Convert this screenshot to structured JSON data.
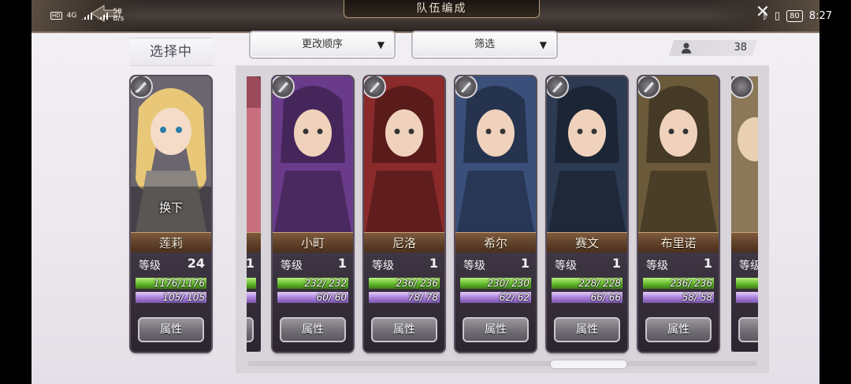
{
  "status_bar": {
    "left_network": "4G",
    "left_speed": "50",
    "left_speed_unit": "B/s",
    "battery": "80",
    "time": "8:27"
  },
  "header": {
    "title": "队伍编成"
  },
  "selecting_label": "选择中",
  "controls": {
    "sort_label": "更改顺序",
    "filter_label": "筛选",
    "unit_count": "38"
  },
  "selected_card": {
    "name": "莲莉",
    "swap_label": "换下",
    "level_label": "等级",
    "level": "24",
    "hp": "1176/1176",
    "mp": "105/  105",
    "attr_label": "属性"
  },
  "cards": [
    {
      "name": "小町",
      "level_label": "等级",
      "level": "1",
      "hp": "232/  232",
      "mp": "60/   60",
      "attr_label": "属性",
      "accent": "#6a3b8a"
    },
    {
      "name": "尼洛",
      "level_label": "等级",
      "level": "1",
      "hp": "236/  236",
      "mp": "78/   78",
      "attr_label": "属性",
      "accent": "#8a2a2a"
    },
    {
      "name": "希尔",
      "level_label": "等级",
      "level": "1",
      "hp": "230/  230",
      "mp": "62/   62",
      "attr_label": "属性",
      "accent": "#3a4f7a"
    },
    {
      "name": "赛文",
      "level_label": "等级",
      "level": "1",
      "hp": "228/  228",
      "mp": "66/   66",
      "attr_label": "属性",
      "accent": "#2c3a52"
    },
    {
      "name": "布里诺",
      "level_label": "等级",
      "level": "1",
      "hp": "236/  236",
      "mp": "58/   58",
      "attr_label": "属性",
      "accent": "#6b5a3a"
    }
  ],
  "partial_left": {
    "level": "1",
    "attr_label": "属性"
  },
  "partial_right": {
    "level_label": "等级",
    "attr_label": "属性"
  }
}
